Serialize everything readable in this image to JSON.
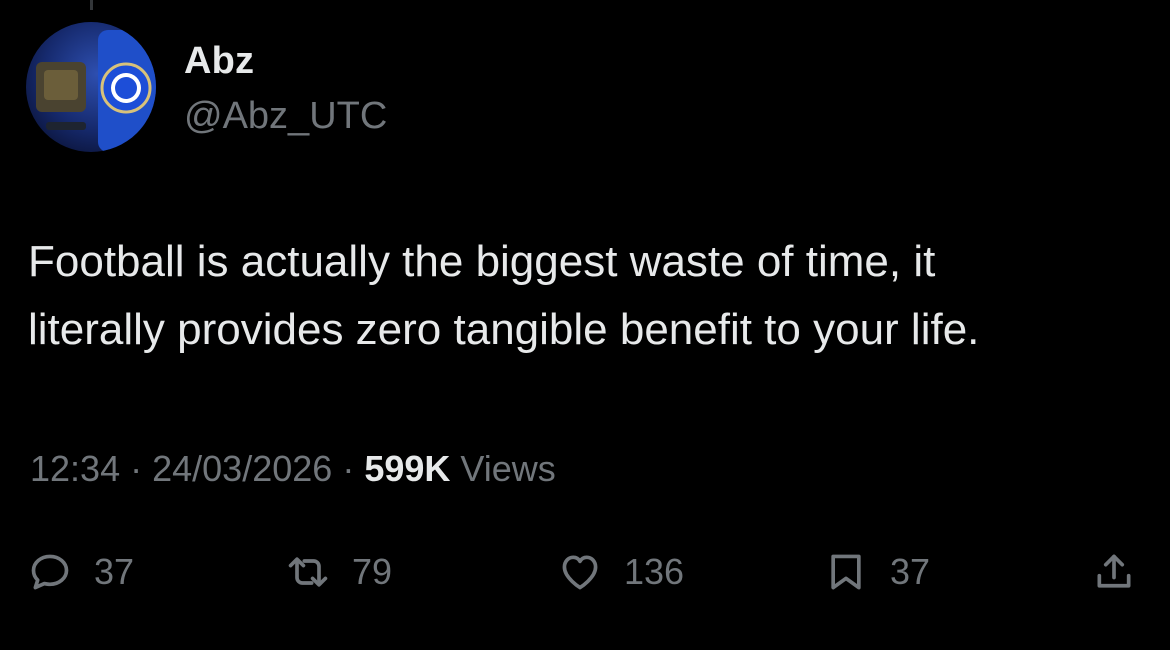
{
  "tweet": {
    "display_name": "Abz",
    "handle": "@Abz_UTC",
    "text": "Football is actually the biggest waste of time, it\nliterally provides zero tangible benefit to your life.",
    "time": "12:34",
    "date": "24/03/2026",
    "views_count": "599K",
    "views_label": "Views"
  },
  "actions": {
    "reply": {
      "icon": "reply-icon",
      "count": "37"
    },
    "retweet": {
      "icon": "retweet-icon",
      "count": "79"
    },
    "like": {
      "icon": "heart-icon",
      "count": "136"
    },
    "bookmark": {
      "icon": "bookmark-icon",
      "count": "37"
    },
    "share": {
      "icon": "share-icon"
    }
  },
  "avatar": {
    "icon": "chelsea-crest-avatar",
    "colors": {
      "background": "#1b2f7a",
      "crest": "#1d4ed8"
    }
  },
  "colors": {
    "background": "#000000",
    "text_primary": "#e7e9ea",
    "text_secondary": "#71767b"
  }
}
